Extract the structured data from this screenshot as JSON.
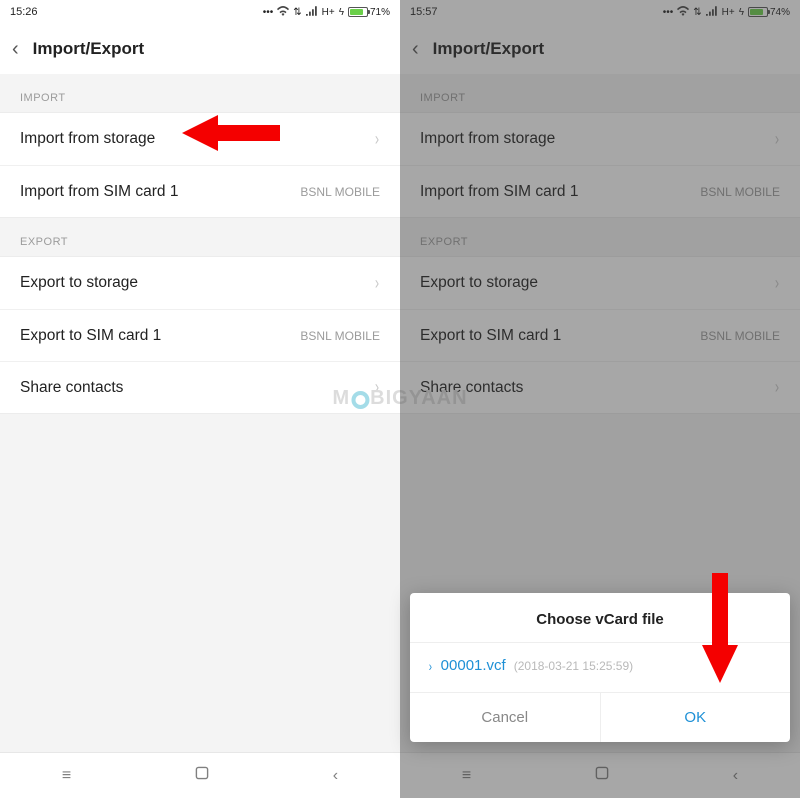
{
  "left": {
    "status": {
      "time": "15:26",
      "network": "H+",
      "battery_pct": "71%"
    },
    "header": {
      "title": "Import/Export"
    },
    "section_import": "IMPORT",
    "section_export": "EXPORT",
    "rows": {
      "import_storage": "Import from storage",
      "import_sim": "Import from SIM card 1",
      "import_sim_meta": "BSNL MOBILE",
      "export_storage": "Export to storage",
      "export_sim": "Export to SIM card 1",
      "export_sim_meta": "BSNL MOBILE",
      "share": "Share contacts"
    }
  },
  "right": {
    "status": {
      "time": "15:57",
      "network": "H+",
      "battery_pct": "74%"
    },
    "header": {
      "title": "Import/Export"
    },
    "section_import": "IMPORT",
    "section_export": "EXPORT",
    "rows": {
      "import_storage": "Import from storage",
      "import_sim": "Import from SIM card 1",
      "import_sim_meta": "BSNL MOBILE",
      "export_storage": "Export to storage",
      "export_sim": "Export to SIM card 1",
      "export_sim_meta": "BSNL MOBILE",
      "share": "Share contacts"
    },
    "dialog": {
      "title": "Choose vCard file",
      "file_name": "00001.vcf",
      "file_date": "(2018-03-21 15:25:59)",
      "cancel": "Cancel",
      "ok": "OK"
    }
  },
  "watermark": {
    "pre": "M",
    "post": "BIGYAAN"
  }
}
